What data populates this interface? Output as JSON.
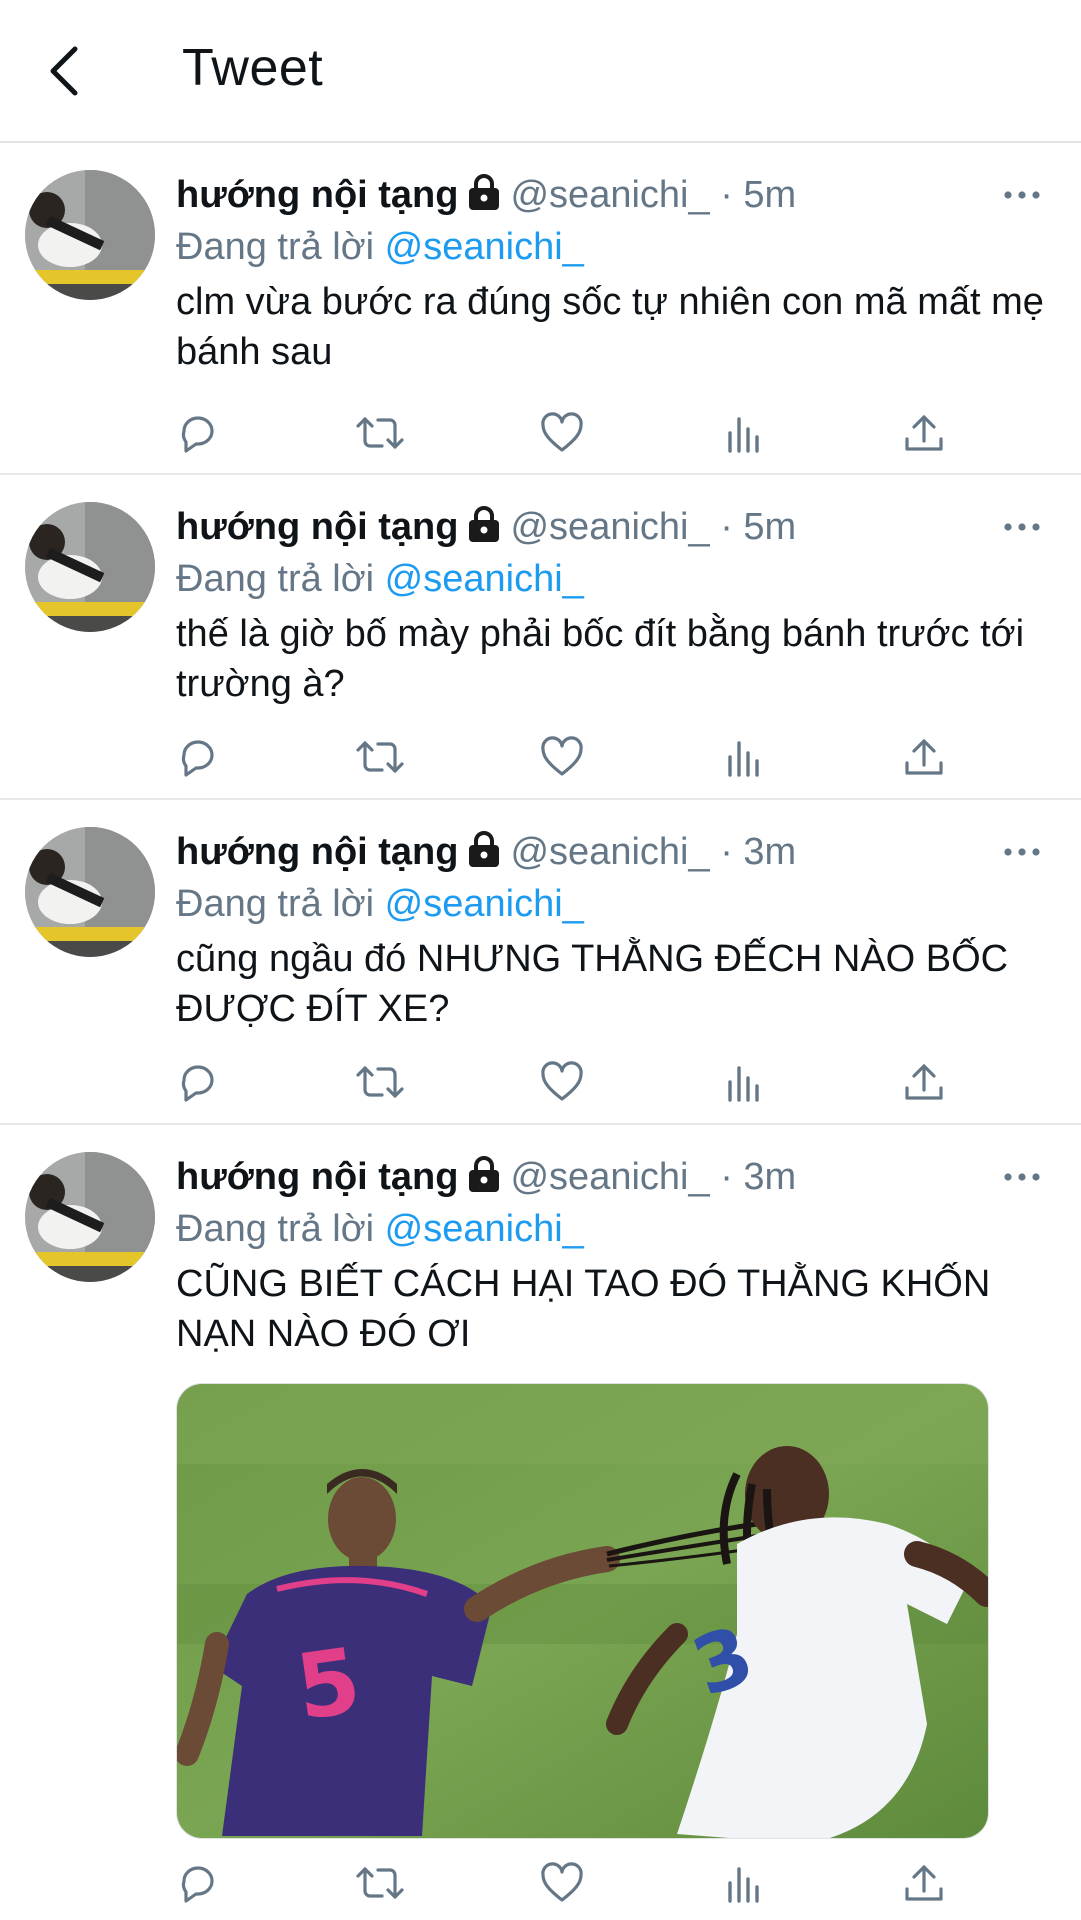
{
  "header": {
    "title": "Tweet",
    "back_icon": "back-arrow-icon"
  },
  "tweets": [
    {
      "name": "hướng nội tạng",
      "handle": "@seanichi_",
      "sep": "·",
      "time": "5m",
      "reply_prefix": "Đang trả lời",
      "reply_to": "@seanichi_",
      "text": "clm vừa bước ra đúng sốc tự nhiên con mã mất mẹ bánh sau"
    },
    {
      "name": "hướng nội tạng",
      "handle": "@seanichi_",
      "sep": "·",
      "time": "5m",
      "reply_prefix": "Đang trả lời",
      "reply_to": "@seanichi_",
      "text": "thế là giờ bố mày phải bốc đít bằng bánh trước tới trường à?"
    },
    {
      "name": "hướng nội tạng",
      "handle": "@seanichi_",
      "sep": "·",
      "time": "3m",
      "reply_prefix": "Đang trả lời",
      "reply_to": "@seanichi_",
      "text": "cũng ngầu đó NHƯNG THẰNG ĐẾCH NÀO BỐC ĐƯỢC ĐÍT XE?"
    },
    {
      "name": "hướng nội tạng",
      "handle": "@seanichi_",
      "sep": "·",
      "time": "3m",
      "reply_prefix": "Đang trả lời",
      "reply_to": "@seanichi_",
      "text": "CŨNG BIẾT CÁCH HẠI TAO ĐÓ THẰNG KHỐN NẠN NÀO ĐÓ ƠI"
    }
  ],
  "action_icons": [
    "reply-icon",
    "retweet-icon",
    "like-icon",
    "analytics-icon",
    "share-icon"
  ],
  "colors": {
    "accent": "#1d9bf0",
    "secondary_text": "#657786",
    "divider": "#e6e9ec"
  }
}
